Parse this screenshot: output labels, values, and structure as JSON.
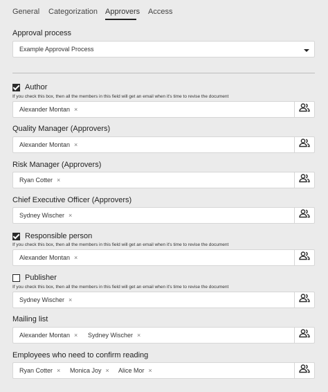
{
  "tabs": [
    {
      "label": "General",
      "active": false
    },
    {
      "label": "Categorization",
      "active": false
    },
    {
      "label": "Approvers",
      "active": true
    },
    {
      "label": "Access",
      "active": false
    }
  ],
  "approval_process": {
    "label": "Approval process",
    "value": "Example Approval Process"
  },
  "hint_text": "If you check this box, then all the members in this field will get an email when it's time to revise the document",
  "fields": [
    {
      "label": "Author",
      "has_checkbox": true,
      "checked": true,
      "members": [
        "Alexander Montan"
      ]
    },
    {
      "label": "Quality Manager (Approvers)",
      "has_checkbox": false,
      "members": [
        "Alexander Montan"
      ]
    },
    {
      "label": "Risk Manager (Approvers)",
      "has_checkbox": false,
      "members": [
        "Ryan Cotter"
      ]
    },
    {
      "label": "Chief Executive Officer (Approvers)",
      "has_checkbox": false,
      "members": [
        "Sydney Wischer"
      ]
    },
    {
      "label": "Responsible person",
      "has_checkbox": true,
      "checked": true,
      "members": [
        "Alexander Montan"
      ]
    },
    {
      "label": "Publisher",
      "has_checkbox": true,
      "checked": false,
      "members": [
        "Sydney Wischer"
      ]
    },
    {
      "label": "Mailing list",
      "has_checkbox": false,
      "members": [
        "Alexander Montan",
        "Sydney Wischer"
      ]
    },
    {
      "label": "Employees who need to confirm reading",
      "has_checkbox": false,
      "members": [
        "Ryan Cotter",
        "Monica Joy",
        "Alice Mor"
      ]
    }
  ],
  "chip_remove_glyph": "×",
  "icons": {
    "user_picker": "users-icon",
    "dropdown": "caret-down-icon",
    "check": "check-icon"
  }
}
